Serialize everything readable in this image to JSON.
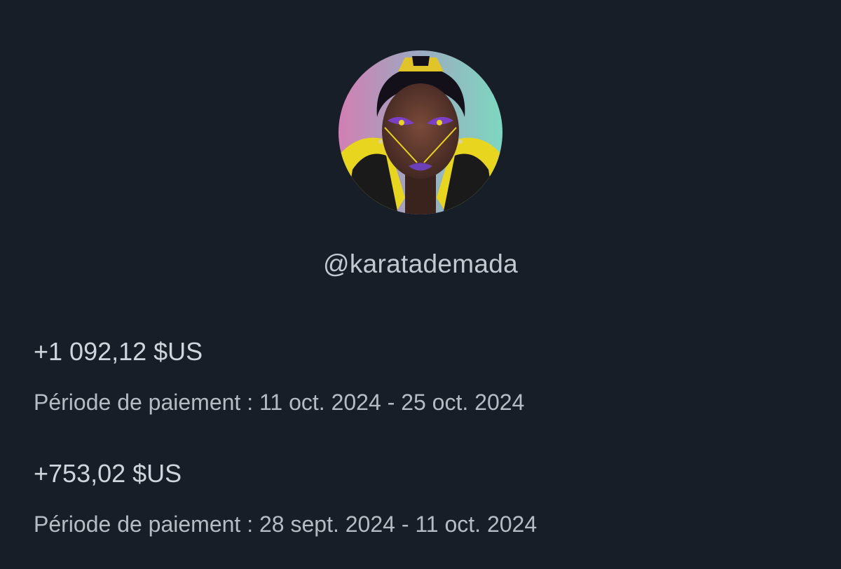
{
  "profile": {
    "avatar_icon": "profile-avatar-illustration",
    "handle": "@karatademada"
  },
  "payments": [
    {
      "amount": "+1 092,12 $US",
      "period": "Période de paiement : 11 oct. 2024 - 25 oct. 2024"
    },
    {
      "amount": "+753,02 $US",
      "period": "Période de paiement : 28 sept. 2024 - 11 oct. 2024"
    }
  ],
  "colors": {
    "background": "#171e27",
    "text_primary": "#cfd5dc",
    "text_secondary": "#b5bcc4"
  }
}
